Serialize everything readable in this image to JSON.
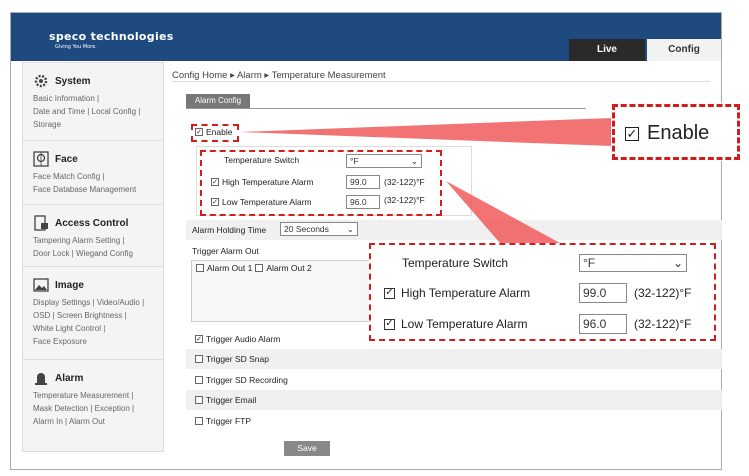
{
  "header": {
    "brand": "speco technologies",
    "tagline": "Giving You More.",
    "tab_live": "Live",
    "tab_config": "Config"
  },
  "sidebar": {
    "sections": [
      {
        "title": "System",
        "links": [
          "Basic Information |",
          "Date and Time | Local Config |",
          "Storage"
        ]
      },
      {
        "title": "Face",
        "links": [
          "Face Match Config |",
          "Face Database Management"
        ]
      },
      {
        "title": "Access Control",
        "links": [
          "Tampering Alarm Setting |",
          "Door Lock | Wiegand Config"
        ]
      },
      {
        "title": "Image",
        "links": [
          "Display Settings | Video/Audio |",
          "OSD | Screen Brightness |",
          "White Light Control |",
          "Face Exposure"
        ]
      },
      {
        "title": "Alarm",
        "links": [
          "Temperature Measurement |",
          "Mask Detection | Exception |",
          "Alarm In | Alarm Out"
        ]
      }
    ]
  },
  "breadcrumb": "Config Home ▸ Alarm ▸ Temperature Measurement",
  "form": {
    "tab": "Alarm Config",
    "enable_label": "Enable",
    "temp_switch_label": "Temperature Switch",
    "temp_switch_value": "°F",
    "high_label": "High Temperature Alarm",
    "high_value": "99.0",
    "low_label": "Low Temperature Alarm",
    "low_value": "96.0",
    "range": "(32-122)°F",
    "holding_label": "Alarm Holding Time",
    "holding_value": "20 Seconds",
    "trigger_out_label": "Trigger Alarm Out",
    "alarm_out_1": "Alarm Out 1",
    "alarm_out_2": "Alarm Out 2",
    "audio_label": "Trigger Audio Alarm",
    "snap_label": "Trigger SD Snap",
    "recording_label": "Trigger SD Recording",
    "email_label": "Trigger Email",
    "ftp_label": "Trigger FTP",
    "save_label": "Save"
  },
  "callout_enable": {
    "label": "Enable"
  },
  "callout_temp": {
    "switch_label": "Temperature Switch",
    "switch_value": "°F",
    "high_label": "High Temperature Alarm",
    "high_value": "99.0",
    "low_label": "Low Temperature Alarm",
    "low_value": "96.0",
    "range": "(32-122)°F"
  },
  "colors": {
    "header": "#1e4a80",
    "highlight": "#d31c1c"
  }
}
